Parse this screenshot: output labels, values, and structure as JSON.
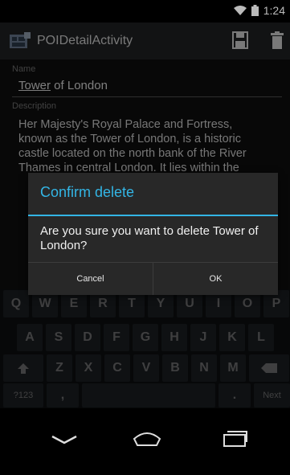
{
  "status_bar": {
    "time": "1:24"
  },
  "action_bar": {
    "title": "POIDetailActivity",
    "save_icon": "save-icon",
    "delete_icon": "trash-icon"
  },
  "form": {
    "name_label": "Name",
    "name_value_underlined": "Tower",
    "name_value_rest": " of London",
    "description_label": "Description",
    "description_lines": [
      "Her Majesty's Royal Palace and Fortress,",
      "known as the Tower of London, is a historic",
      "castle located on the north bank of the River",
      "Thames in central London. It lies within the"
    ]
  },
  "dialog": {
    "title": "Confirm delete",
    "message": "Are you sure you want to delete Tower of London?",
    "cancel_label": "Cancel",
    "ok_label": "OK",
    "accent_color": "#33b5e5"
  },
  "keyboard": {
    "row1": [
      "Q",
      "W",
      "E",
      "R",
      "T",
      "Y",
      "U",
      "I",
      "O",
      "P"
    ],
    "row2": [
      "A",
      "S",
      "D",
      "F",
      "G",
      "H",
      "J",
      "K",
      "L"
    ],
    "row3": [
      "Z",
      "X",
      "C",
      "V",
      "B",
      "N",
      "M"
    ],
    "symbols_label": "?123",
    "comma_label": ",",
    "period_label": ".",
    "next_label": "Next"
  }
}
